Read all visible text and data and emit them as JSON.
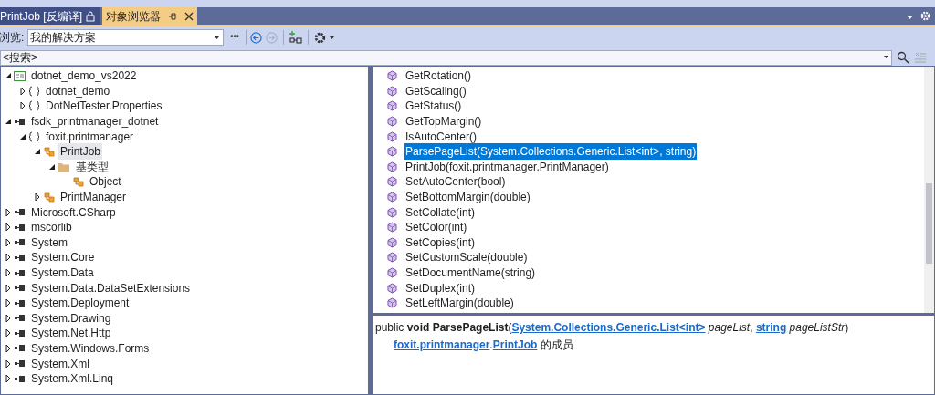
{
  "tabs": [
    {
      "label": "PrintJob [反编译]",
      "selected": false,
      "locked": true
    },
    {
      "label": "对象浏览器",
      "selected": true,
      "locked": false
    }
  ],
  "toolbar": {
    "browse_label": "浏览:",
    "scope": "我的解决方案",
    "more": "•••"
  },
  "search": {
    "placeholder": "<搜索>"
  },
  "tree": [
    {
      "label": "dotnet_demo_vs2022",
      "kind": "project",
      "expanded": true,
      "selected": false,
      "children": [
        {
          "label": "dotnet_demo",
          "kind": "namespace",
          "expanded": false,
          "selected": false
        },
        {
          "label": "DotNetTester.Properties",
          "kind": "namespace",
          "expanded": false,
          "selected": false
        }
      ]
    },
    {
      "label": "fsdk_printmanager_dotnet",
      "kind": "assembly",
      "expanded": true,
      "selected": false,
      "children": [
        {
          "label": "foxit.printmanager",
          "kind": "namespace",
          "expanded": true,
          "selected": false,
          "children": [
            {
              "label": "PrintJob",
              "kind": "class",
              "expanded": true,
              "selected": true,
              "children": [
                {
                  "label": "基类型",
                  "kind": "folder",
                  "expanded": true,
                  "selected": false,
                  "children": [
                    {
                      "label": "Object",
                      "kind": "class",
                      "selected": false
                    }
                  ]
                }
              ]
            },
            {
              "label": "PrintManager",
              "kind": "class",
              "expanded": false,
              "selected": false
            }
          ]
        }
      ]
    },
    {
      "label": "Microsoft.CSharp",
      "kind": "assembly",
      "expanded": false,
      "selected": false
    },
    {
      "label": "mscorlib",
      "kind": "assembly",
      "expanded": false,
      "selected": false
    },
    {
      "label": "System",
      "kind": "assembly",
      "expanded": false,
      "selected": false
    },
    {
      "label": "System.Core",
      "kind": "assembly",
      "expanded": false,
      "selected": false
    },
    {
      "label": "System.Data",
      "kind": "assembly",
      "expanded": false,
      "selected": false
    },
    {
      "label": "System.Data.DataSetExtensions",
      "kind": "assembly",
      "expanded": false,
      "selected": false
    },
    {
      "label": "System.Deployment",
      "kind": "assembly",
      "expanded": false,
      "selected": false
    },
    {
      "label": "System.Drawing",
      "kind": "assembly",
      "expanded": false,
      "selected": false
    },
    {
      "label": "System.Net.Http",
      "kind": "assembly",
      "expanded": false,
      "selected": false
    },
    {
      "label": "System.Windows.Forms",
      "kind": "assembly",
      "expanded": false,
      "selected": false
    },
    {
      "label": "System.Xml",
      "kind": "assembly",
      "expanded": false,
      "selected": false
    },
    {
      "label": "System.Xml.Linq",
      "kind": "assembly",
      "expanded": false,
      "selected": false
    }
  ],
  "members": [
    {
      "label": "GetRotation()",
      "selected": false
    },
    {
      "label": "GetScaling()",
      "selected": false
    },
    {
      "label": "GetStatus()",
      "selected": false
    },
    {
      "label": "GetTopMargin()",
      "selected": false
    },
    {
      "label": "IsAutoCenter()",
      "selected": false
    },
    {
      "label": "ParsePageList(System.Collections.Generic.List<int>, string)",
      "selected": true
    },
    {
      "label": "PrintJob(foxit.printmanager.PrintManager)",
      "selected": false
    },
    {
      "label": "SetAutoCenter(bool)",
      "selected": false
    },
    {
      "label": "SetBottomMargin(double)",
      "selected": false
    },
    {
      "label": "SetCollate(int)",
      "selected": false
    },
    {
      "label": "SetColor(int)",
      "selected": false
    },
    {
      "label": "SetCopies(int)",
      "selected": false
    },
    {
      "label": "SetCustomScale(double)",
      "selected": false
    },
    {
      "label": "SetDocumentName(string)",
      "selected": false
    },
    {
      "label": "SetDuplex(int)",
      "selected": false
    },
    {
      "label": "SetLeftMargin(double)",
      "selected": false
    }
  ],
  "detail": {
    "signature": [
      {
        "kind": "text",
        "text": "public **void ParsePageList**("
      },
      {
        "kind": "link",
        "text": "System.Collections.Generic.List<int>"
      },
      {
        "kind": "text",
        "text": " *pageList*, "
      },
      {
        "kind": "link",
        "text": "string"
      },
      {
        "kind": "text",
        "text": " *pageListStr*)"
      }
    ],
    "member_of": [
      {
        "kind": "link",
        "text": "foxit.printmanager"
      },
      {
        "kind": "text",
        "text": "."
      },
      {
        "kind": "link",
        "text": "PrintJob"
      },
      {
        "kind": "text",
        "text": " 的成员"
      }
    ]
  }
}
